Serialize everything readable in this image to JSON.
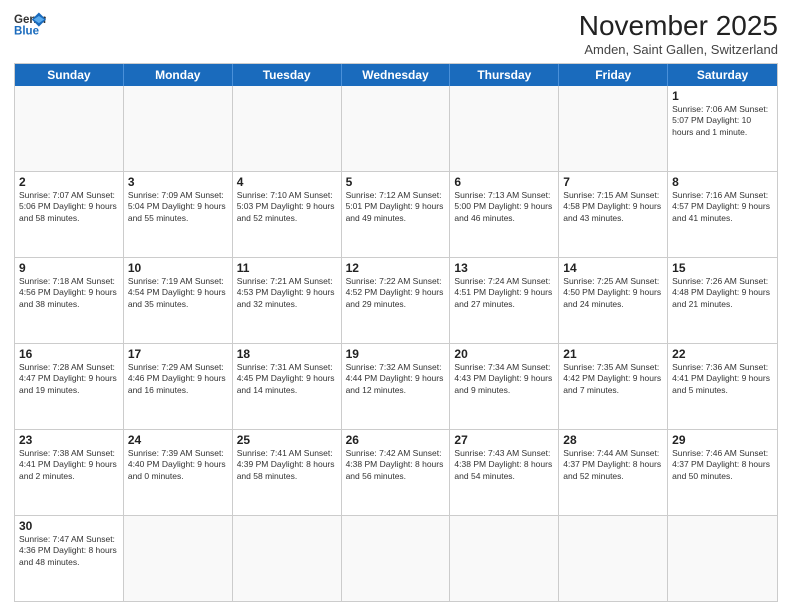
{
  "header": {
    "logo_general": "General",
    "logo_blue": "Blue",
    "month_title": "November 2025",
    "subtitle": "Amden, Saint Gallen, Switzerland"
  },
  "day_headers": [
    "Sunday",
    "Monday",
    "Tuesday",
    "Wednesday",
    "Thursday",
    "Friday",
    "Saturday"
  ],
  "weeks": [
    [
      {
        "num": "",
        "info": "",
        "empty": true
      },
      {
        "num": "",
        "info": "",
        "empty": true
      },
      {
        "num": "",
        "info": "",
        "empty": true
      },
      {
        "num": "",
        "info": "",
        "empty": true
      },
      {
        "num": "",
        "info": "",
        "empty": true
      },
      {
        "num": "",
        "info": "",
        "empty": true
      },
      {
        "num": "1",
        "info": "Sunrise: 7:06 AM\nSunset: 5:07 PM\nDaylight: 10 hours\nand 1 minute.",
        "empty": false
      }
    ],
    [
      {
        "num": "2",
        "info": "Sunrise: 7:07 AM\nSunset: 5:06 PM\nDaylight: 9 hours\nand 58 minutes.",
        "empty": false
      },
      {
        "num": "3",
        "info": "Sunrise: 7:09 AM\nSunset: 5:04 PM\nDaylight: 9 hours\nand 55 minutes.",
        "empty": false
      },
      {
        "num": "4",
        "info": "Sunrise: 7:10 AM\nSunset: 5:03 PM\nDaylight: 9 hours\nand 52 minutes.",
        "empty": false
      },
      {
        "num": "5",
        "info": "Sunrise: 7:12 AM\nSunset: 5:01 PM\nDaylight: 9 hours\nand 49 minutes.",
        "empty": false
      },
      {
        "num": "6",
        "info": "Sunrise: 7:13 AM\nSunset: 5:00 PM\nDaylight: 9 hours\nand 46 minutes.",
        "empty": false
      },
      {
        "num": "7",
        "info": "Sunrise: 7:15 AM\nSunset: 4:58 PM\nDaylight: 9 hours\nand 43 minutes.",
        "empty": false
      },
      {
        "num": "8",
        "info": "Sunrise: 7:16 AM\nSunset: 4:57 PM\nDaylight: 9 hours\nand 41 minutes.",
        "empty": false
      }
    ],
    [
      {
        "num": "9",
        "info": "Sunrise: 7:18 AM\nSunset: 4:56 PM\nDaylight: 9 hours\nand 38 minutes.",
        "empty": false
      },
      {
        "num": "10",
        "info": "Sunrise: 7:19 AM\nSunset: 4:54 PM\nDaylight: 9 hours\nand 35 minutes.",
        "empty": false
      },
      {
        "num": "11",
        "info": "Sunrise: 7:21 AM\nSunset: 4:53 PM\nDaylight: 9 hours\nand 32 minutes.",
        "empty": false
      },
      {
        "num": "12",
        "info": "Sunrise: 7:22 AM\nSunset: 4:52 PM\nDaylight: 9 hours\nand 29 minutes.",
        "empty": false
      },
      {
        "num": "13",
        "info": "Sunrise: 7:24 AM\nSunset: 4:51 PM\nDaylight: 9 hours\nand 27 minutes.",
        "empty": false
      },
      {
        "num": "14",
        "info": "Sunrise: 7:25 AM\nSunset: 4:50 PM\nDaylight: 9 hours\nand 24 minutes.",
        "empty": false
      },
      {
        "num": "15",
        "info": "Sunrise: 7:26 AM\nSunset: 4:48 PM\nDaylight: 9 hours\nand 21 minutes.",
        "empty": false
      }
    ],
    [
      {
        "num": "16",
        "info": "Sunrise: 7:28 AM\nSunset: 4:47 PM\nDaylight: 9 hours\nand 19 minutes.",
        "empty": false
      },
      {
        "num": "17",
        "info": "Sunrise: 7:29 AM\nSunset: 4:46 PM\nDaylight: 9 hours\nand 16 minutes.",
        "empty": false
      },
      {
        "num": "18",
        "info": "Sunrise: 7:31 AM\nSunset: 4:45 PM\nDaylight: 9 hours\nand 14 minutes.",
        "empty": false
      },
      {
        "num": "19",
        "info": "Sunrise: 7:32 AM\nSunset: 4:44 PM\nDaylight: 9 hours\nand 12 minutes.",
        "empty": false
      },
      {
        "num": "20",
        "info": "Sunrise: 7:34 AM\nSunset: 4:43 PM\nDaylight: 9 hours\nand 9 minutes.",
        "empty": false
      },
      {
        "num": "21",
        "info": "Sunrise: 7:35 AM\nSunset: 4:42 PM\nDaylight: 9 hours\nand 7 minutes.",
        "empty": false
      },
      {
        "num": "22",
        "info": "Sunrise: 7:36 AM\nSunset: 4:41 PM\nDaylight: 9 hours\nand 5 minutes.",
        "empty": false
      }
    ],
    [
      {
        "num": "23",
        "info": "Sunrise: 7:38 AM\nSunset: 4:41 PM\nDaylight: 9 hours\nand 2 minutes.",
        "empty": false
      },
      {
        "num": "24",
        "info": "Sunrise: 7:39 AM\nSunset: 4:40 PM\nDaylight: 9 hours\nand 0 minutes.",
        "empty": false
      },
      {
        "num": "25",
        "info": "Sunrise: 7:41 AM\nSunset: 4:39 PM\nDaylight: 8 hours\nand 58 minutes.",
        "empty": false
      },
      {
        "num": "26",
        "info": "Sunrise: 7:42 AM\nSunset: 4:38 PM\nDaylight: 8 hours\nand 56 minutes.",
        "empty": false
      },
      {
        "num": "27",
        "info": "Sunrise: 7:43 AM\nSunset: 4:38 PM\nDaylight: 8 hours\nand 54 minutes.",
        "empty": false
      },
      {
        "num": "28",
        "info": "Sunrise: 7:44 AM\nSunset: 4:37 PM\nDaylight: 8 hours\nand 52 minutes.",
        "empty": false
      },
      {
        "num": "29",
        "info": "Sunrise: 7:46 AM\nSunset: 4:37 PM\nDaylight: 8 hours\nand 50 minutes.",
        "empty": false
      }
    ],
    [
      {
        "num": "30",
        "info": "Sunrise: 7:47 AM\nSunset: 4:36 PM\nDaylight: 8 hours\nand 48 minutes.",
        "empty": false
      },
      {
        "num": "",
        "info": "",
        "empty": true
      },
      {
        "num": "",
        "info": "",
        "empty": true
      },
      {
        "num": "",
        "info": "",
        "empty": true
      },
      {
        "num": "",
        "info": "",
        "empty": true
      },
      {
        "num": "",
        "info": "",
        "empty": true
      },
      {
        "num": "",
        "info": "",
        "empty": true
      }
    ]
  ]
}
